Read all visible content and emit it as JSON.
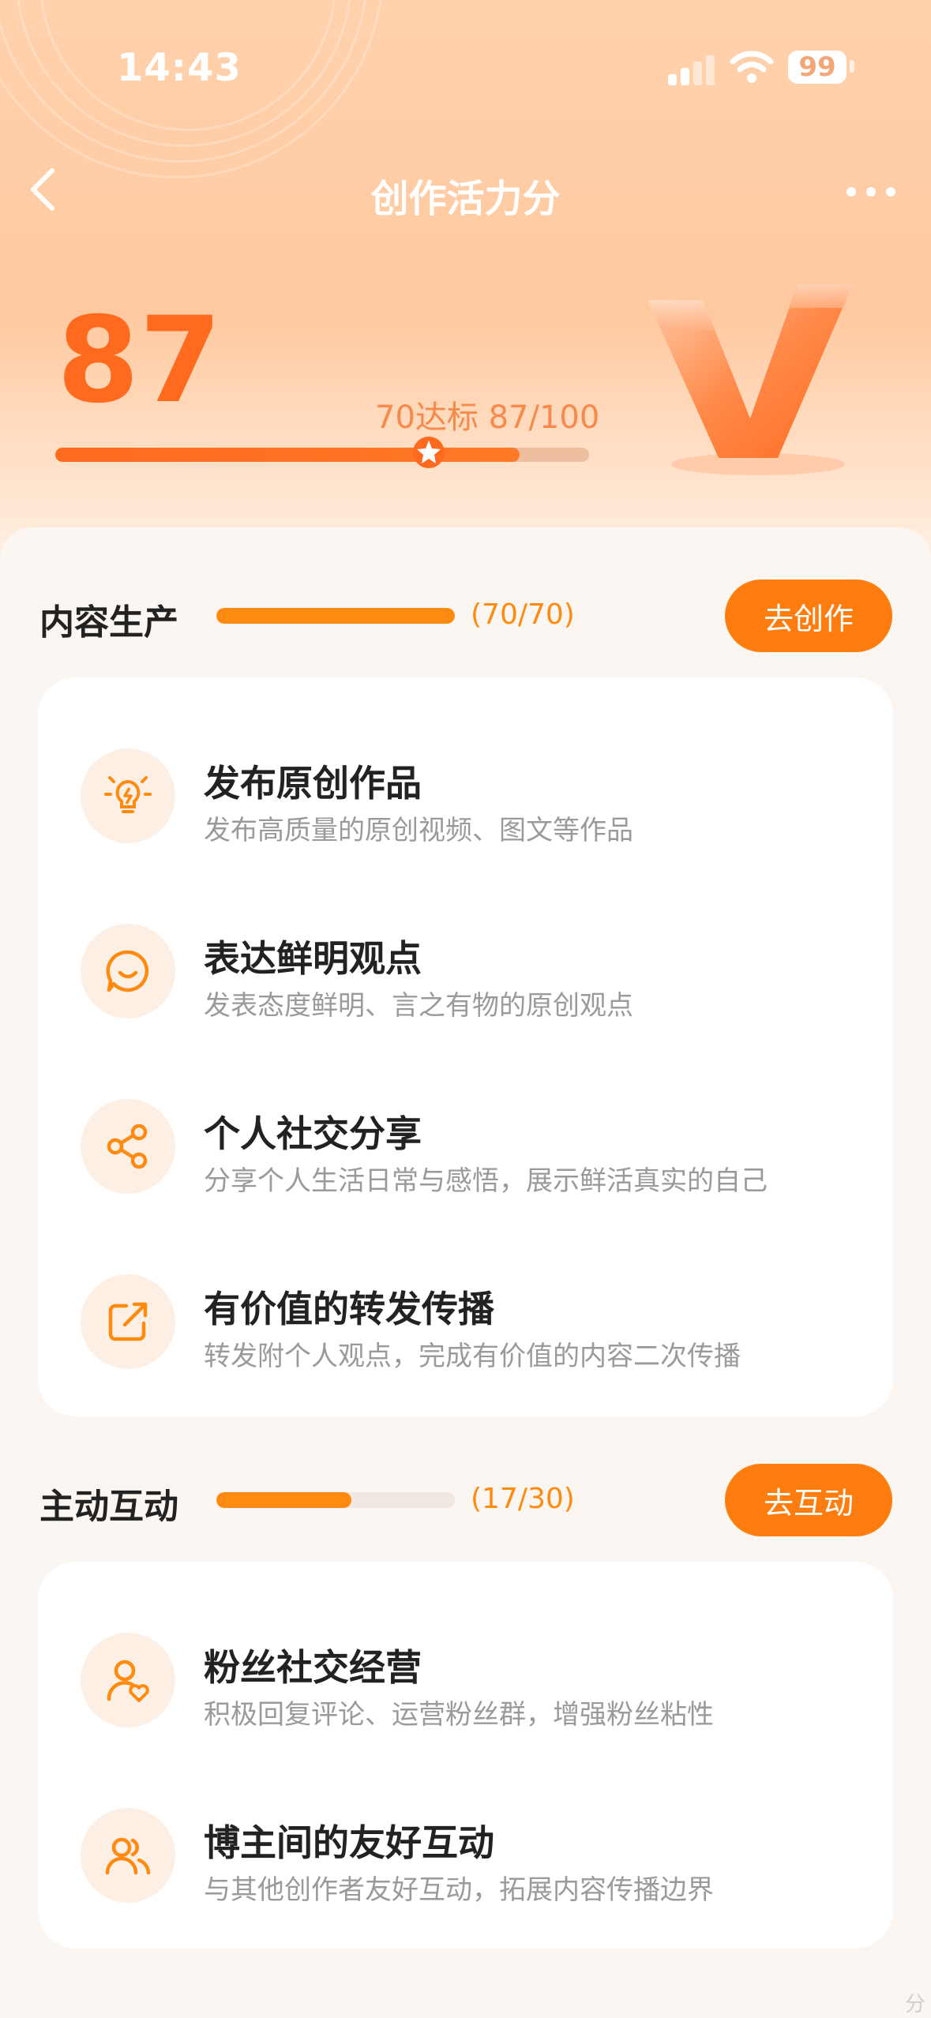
{
  "status_bar": {
    "time": "14:43",
    "battery": "99"
  },
  "nav": {
    "title": "创作活力分"
  },
  "score": {
    "value": "87",
    "standard_text": "70达标 87/100",
    "progress": 0.87,
    "standard_mark": 0.7
  },
  "colors": {
    "accent": "#ff7d0e",
    "score": "#ff6a1f",
    "muted": "#9a9a9a"
  },
  "sections": [
    {
      "title": "内容生产",
      "count": "(70/70)",
      "progress": 1.0,
      "button": "去创作",
      "items": [
        {
          "icon": "lightbulb-icon",
          "title": "发布原创作品",
          "desc": "发布高质量的原创视频、图文等作品"
        },
        {
          "icon": "chat-smile-icon",
          "title": "表达鲜明观点",
          "desc": "发表态度鲜明、言之有物的原创观点"
        },
        {
          "icon": "share-icon",
          "title": "个人社交分享",
          "desc": "分享个人生活日常与感悟，展示鲜活真实的自己"
        },
        {
          "icon": "forward-icon",
          "title": "有价值的转发传播",
          "desc": "转发附个人观点，完成有价值的内容二次传播"
        }
      ]
    },
    {
      "title": "主动互动",
      "count": "(17/30)",
      "progress": 0.567,
      "button": "去互动",
      "items": [
        {
          "icon": "user-heart-icon",
          "title": "粉丝社交经营",
          "desc": "积极回复评论、运营粉丝群，增强粉丝粘性"
        },
        {
          "icon": "users-icon",
          "title": "博主间的友好互动",
          "desc": "与其他创作者友好互动，拓展内容传播边界"
        }
      ]
    }
  ]
}
